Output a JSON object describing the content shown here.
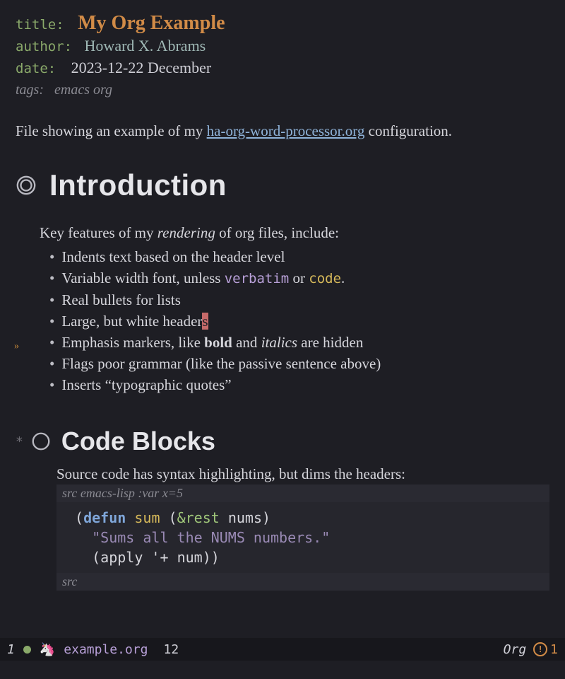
{
  "meta": {
    "title_key": "title",
    "title_val": "My Org Example",
    "author_key": "author",
    "author_val": "Howard X. Abrams",
    "date_key": "date",
    "date_val": "2023-12-22 December",
    "tags_key": "tags:",
    "tags_val": "emacs org"
  },
  "intro": {
    "pre": "File showing an example of my ",
    "link": "ha-org-word-processor.org",
    "post": " configuration."
  },
  "h1": "Introduction",
  "para1": {
    "a": "Key features of my ",
    "em": "rendering",
    "b": " of org files, include:"
  },
  "bullets": {
    "b0": "Indents text based on the header level",
    "b1a": "Variable width font, unless ",
    "b1v": "verbatim",
    "b1b": " or ",
    "b1c": "code",
    "b1d": ".",
    "b2": "Real bullets for lists",
    "b3a": "Large, but white header",
    "b3cur": "s",
    "b4a": "Emphasis markers, like ",
    "b4bold": "bold",
    "b4b": " and ",
    "b4it": "italics",
    "b4c": " are hidden",
    "b5": "Flags poor grammar (like the passive sentence above)",
    "b6": "Inserts “typographic quotes”"
  },
  "h2": "Code Blocks",
  "h2_text": "Source code has syntax highlighting, but dims the headers:",
  "src": {
    "header_pre": "src ",
    "header_lang": "emacs-lisp :var x=5",
    "l1_open": "(",
    "l1_defun": "defun",
    "l1_sp": " ",
    "l1_name": "sum",
    "l1_args_open": " (",
    "l1_amp": "&rest",
    "l1_argname": " nums",
    "l1_args_close": ")",
    "l2_doc": "\"Sums all the NUMS numbers.\"",
    "l3_open": "(",
    "l3_apply": "apply ",
    "l3_quote": "'",
    "l3_plus": "+ ",
    "l3_num": "num",
    "l3_close": "))",
    "footer": "src"
  },
  "modeline": {
    "win": "1",
    "file": "example.org",
    "line": "12",
    "mode": "Org",
    "warn": "1"
  },
  "fringe_arrow": "»"
}
